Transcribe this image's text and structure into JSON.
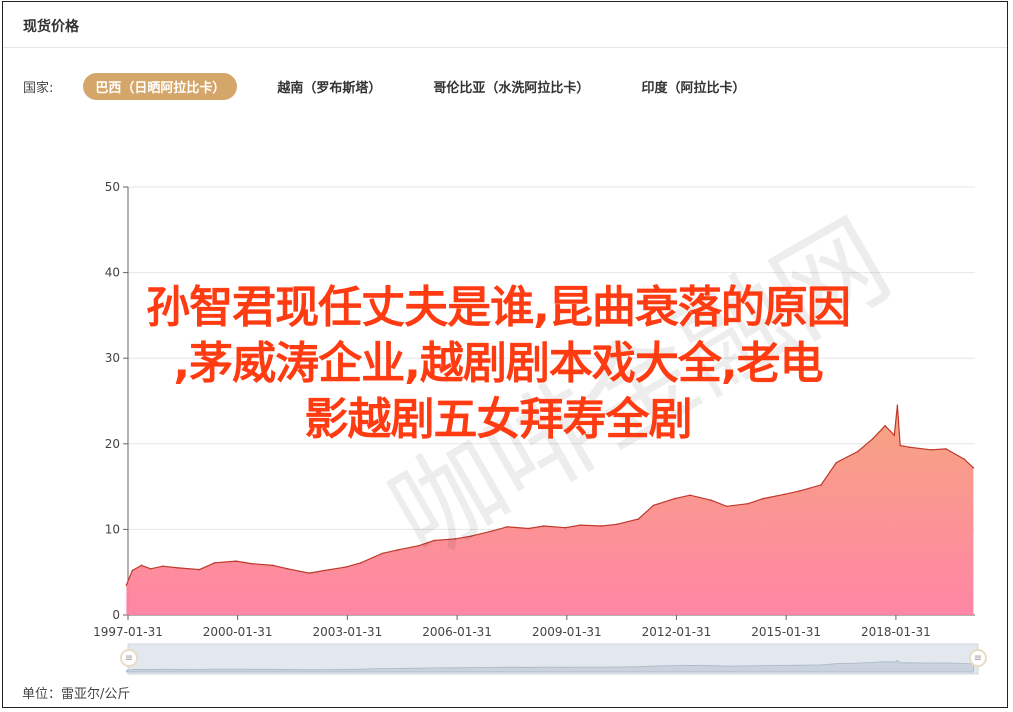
{
  "header": {
    "title": "现货价格"
  },
  "country_filter": {
    "label": "国家:",
    "options": [
      "巴西（日晒阿拉比卡）",
      "越南（罗布斯塔）",
      "哥伦比亚（水洗阿拉比卡）",
      "印度（阿拉比卡）"
    ],
    "selected_index": 0
  },
  "unit_label": "单位：雷亚尔/公斤",
  "overlay_text": [
    "孙智君现任丈夫是谁,昆曲衰落的原因",
    ",茅威涛企业,越剧剧本戏大全,老电",
    "影越剧五女拜寿全剧"
  ],
  "watermark_text": "咖啡金融网",
  "colors": {
    "accent": "#d4a66a",
    "area_top": "#f6a07a",
    "area_bottom": "#ff7fa0",
    "line": "#c0392b",
    "overlay": "#ff3b12"
  },
  "chart_data": {
    "type": "area",
    "title": "",
    "xlabel": "",
    "ylabel": "",
    "ylim": [
      0,
      50
    ],
    "yticks": [
      "0",
      "10",
      "20",
      "30",
      "40",
      "50"
    ],
    "xticks": [
      "1997-01-31",
      "2000-01-31",
      "2003-01-31",
      "2006-01-31",
      "2009-01-31",
      "2012-01-31",
      "2015-01-31",
      "2018-01-31"
    ],
    "grid": true,
    "x": [
      "1997-01",
      "1997-03",
      "1997-06",
      "1997-09",
      "1998-01",
      "1998-06",
      "1999-01",
      "1999-06",
      "2000-01",
      "2000-06",
      "2001-01",
      "2001-06",
      "2002-01",
      "2002-06",
      "2003-01",
      "2003-06",
      "2004-01",
      "2004-06",
      "2005-01",
      "2005-06",
      "2006-01",
      "2006-06",
      "2007-01",
      "2007-06",
      "2008-01",
      "2008-06",
      "2009-01",
      "2009-06",
      "2010-01",
      "2010-06",
      "2011-01",
      "2011-06",
      "2012-01",
      "2012-06",
      "2013-01",
      "2013-06",
      "2014-01",
      "2014-06",
      "2015-01",
      "2015-06",
      "2016-01",
      "2016-06",
      "2017-01",
      "2017-06",
      "2017-10",
      "2018-01",
      "2018-02",
      "2018-03",
      "2018-06",
      "2019-01",
      "2019-06",
      "2019-12",
      "2020-03"
    ],
    "series": [
      {
        "values": [
          3.5,
          5.2,
          5.8,
          5.4,
          5.7,
          5.5,
          5.3,
          6.1,
          6.3,
          6.0,
          5.8,
          5.4,
          4.9,
          5.2,
          5.6,
          6.1,
          7.2,
          7.6,
          8.1,
          8.7,
          8.9,
          9.2,
          9.8,
          10.3,
          10.1,
          10.4,
          10.2,
          10.5,
          10.4,
          10.6,
          11.2,
          12.8,
          13.6,
          14.0,
          13.4,
          12.7,
          13.0,
          13.6,
          14.1,
          14.5,
          15.2,
          17.8,
          19.1,
          20.6,
          22.1,
          21.0,
          24.5,
          19.8,
          19.6,
          19.3,
          19.4,
          18.2,
          17.2
        ]
      }
    ]
  },
  "slider": {
    "start_handle": "≡",
    "end_handle": "≡"
  }
}
